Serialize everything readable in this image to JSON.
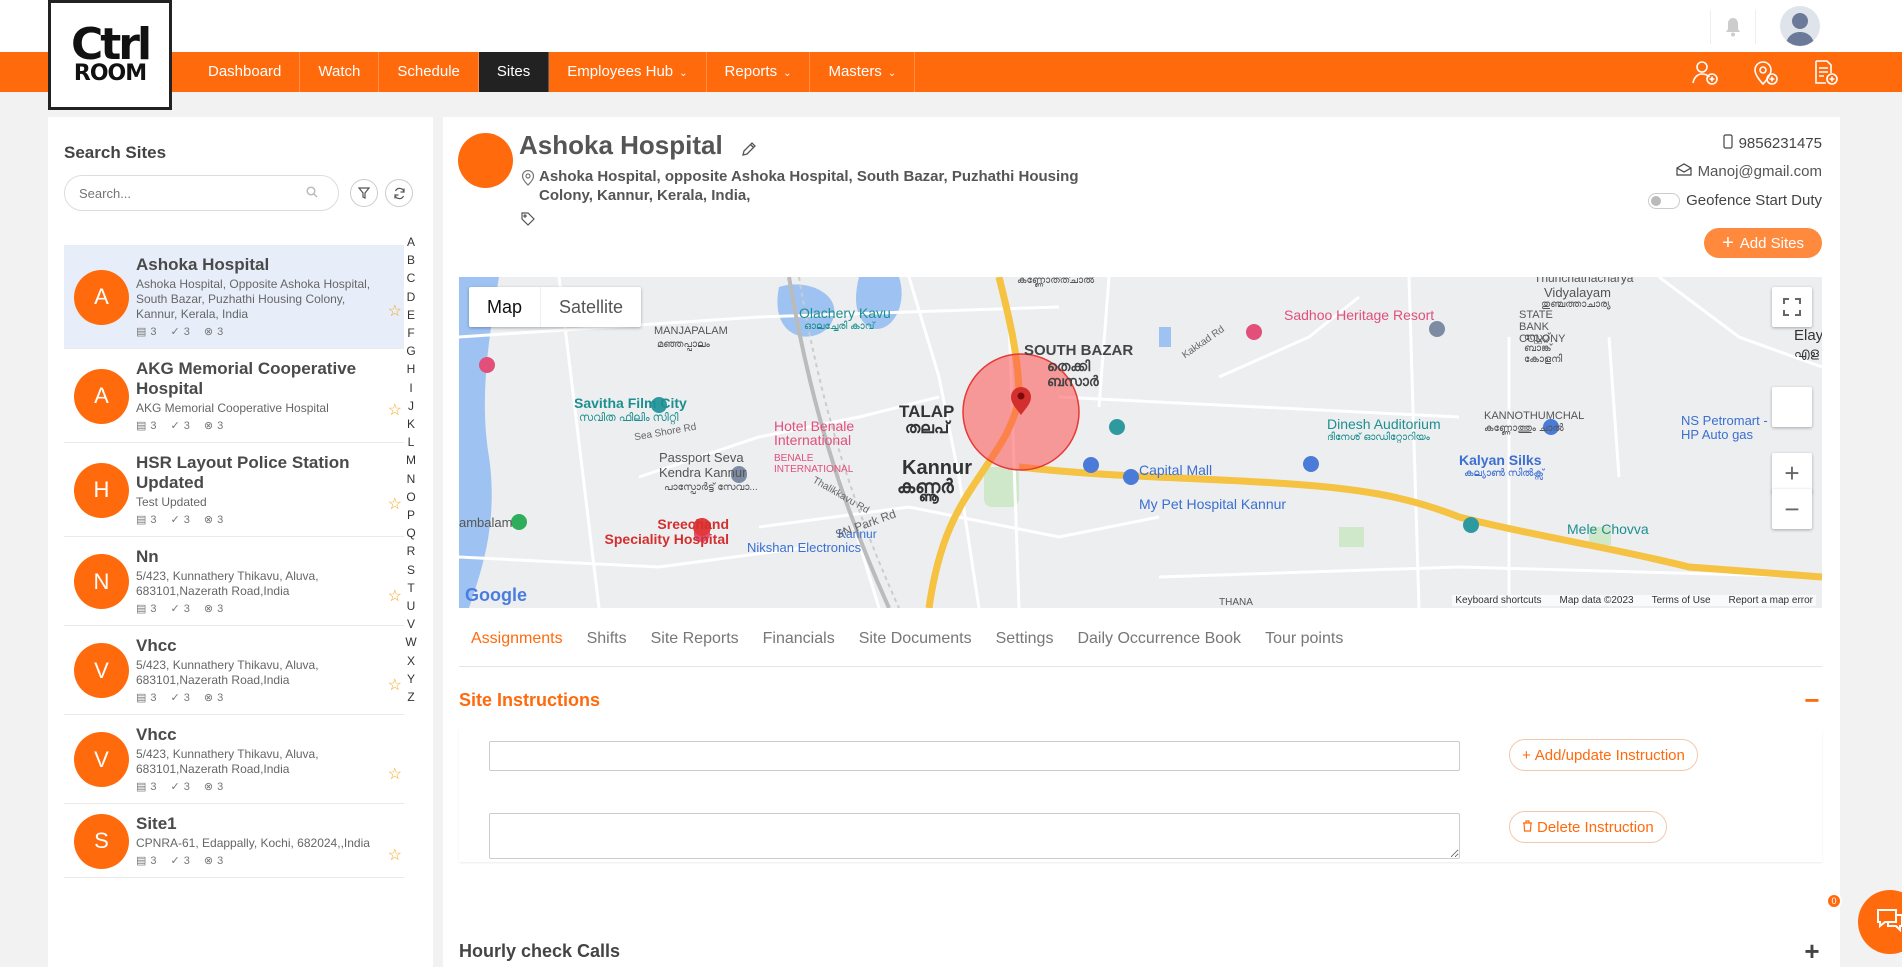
{
  "brand": {
    "logo_line1": "Ctrl",
    "logo_line2": "ROOM",
    "accent": "#ff6a0d"
  },
  "nav": {
    "items": [
      {
        "label": "Dashboard"
      },
      {
        "label": "Watch"
      },
      {
        "label": "Schedule"
      },
      {
        "label": "Sites",
        "active": true
      },
      {
        "label": "Employees Hub",
        "dropdown": true
      },
      {
        "label": "Reports",
        "dropdown": true
      },
      {
        "label": "Masters",
        "dropdown": true
      }
    ],
    "right_icons": [
      "add-user-icon",
      "add-location-icon",
      "add-document-icon"
    ]
  },
  "sidebar": {
    "title": "Search Sites",
    "search_placeholder": "Search...",
    "sites": [
      {
        "initial": "A",
        "name": "Ashoka Hospital",
        "address": "Ashoka Hospital, Opposite Ashoka Hospital, South Bazar, Puzhathi Housing Colony, Kannur, Kerala, India",
        "c1": "3",
        "c2": "3",
        "c3": "3",
        "selected": true
      },
      {
        "initial": "A",
        "name": "AKG Memorial Cooperative Hospital",
        "address": "AKG Memorial Cooperative Hospital",
        "c1": "3",
        "c2": "3",
        "c3": "3"
      },
      {
        "initial": "H",
        "name": "HSR Layout Police Station Updated",
        "address": "Test Updated",
        "c1": "3",
        "c2": "3",
        "c3": "3"
      },
      {
        "initial": "N",
        "name": "Nn",
        "address": "5/423, Kunnathery Thikavu, Aluva, 683101,Nazerath Road,India",
        "c1": "3",
        "c2": "3",
        "c3": "3"
      },
      {
        "initial": "V",
        "name": "Vhcc",
        "address": "5/423, Kunnathery Thikavu, Aluva, 683101,Nazerath Road,India",
        "c1": "3",
        "c2": "3",
        "c3": "3"
      },
      {
        "initial": "V",
        "name": "Vhcc",
        "address": "5/423, Kunnathery Thikavu, Aluva, 683101,Nazerath Road,India",
        "c1": "3",
        "c2": "3",
        "c3": "3"
      },
      {
        "initial": "S",
        "name": "Site1",
        "address": "CPNRA-61, Edappally, Kochi, 682024,,India",
        "c1": "3",
        "c2": "3",
        "c3": "3"
      }
    ],
    "alphabet": [
      "A",
      "B",
      "C",
      "D",
      "E",
      "F",
      "G",
      "H",
      "I",
      "J",
      "K",
      "L",
      "M",
      "N",
      "O",
      "P",
      "Q",
      "R",
      "S",
      "T",
      "U",
      "V",
      "W",
      "X",
      "Y",
      "Z"
    ]
  },
  "site": {
    "name": "Ashoka Hospital",
    "address": "Ashoka Hospital, opposite Ashoka Hospital, South Bazar, Puzhathi Housing Colony, Kannur, Kerala, India,",
    "phone": "9856231475",
    "email": "Manoj@gmail.com",
    "geofence_label": "Geofence Start Duty",
    "geofence_on": false,
    "add_sites_label": "Add Sites"
  },
  "map": {
    "type_map": "Map",
    "type_satellite": "Satellite",
    "labels": {
      "talap": "TALAP",
      "talap_ml": "തലപ്",
      "kannur": "Kannur",
      "kannur_ml": "കണ്ണൂർ",
      "south_bazar": "SOUTH BAZAR",
      "south_bazar_ml": "തെക്കി ബസാർ",
      "savitha": "Savitha Film City",
      "savitha_ml": "സവിത ഫിലിം സിറ്റി",
      "hotel": "Hotel Benale International",
      "hotel_sub": "BENALE INTERNATIONAL",
      "passport": "Passport Seva Kendra Kannur",
      "sreechand": "Sreechand Speciality Hospital",
      "capital": "Capital Mall",
      "petshop": "My Pet Hospital Kannur",
      "dinesh": "Dinesh Auditorium",
      "dinesh_ml": "ദിനേശ് ഓഡിറ്റോറിയം",
      "kalyan": "Kalyan Silks",
      "kalyan_ml": "കല്യാൺ സിൽക്സ്",
      "sadhoo": "Sadhoo Heritage Resort",
      "olachery": "Olachery Kavu",
      "olachery_ml": "ഓലച്ചേരി കാവ്",
      "manjapalam": "MANJAPALAM",
      "manjapalam_ml": "മഞ്ഞപ്പാലം",
      "statebank": "STATE BANK COLONY",
      "statebank_ml": "സ്റ്റേറ്റ് ബാങ്ക് കോളനി",
      "kannothumchal": "KANNOTHUMCHAL",
      "kannothumchal_ml": "കണ്ണോത്തും ചാൽ",
      "ns_petromart": "NS Petromart - HP Auto gas",
      "mele_chovva": "Mele Chovva",
      "nikshan": "Nikshan Electronics",
      "kannur_stn": "Kannur",
      "vidyalayam": "Vidyalayam",
      "thunchathacharya": "Thunchathacharya",
      "thunchathacharya_ml": "തുഞ്ചത്താചാര്യ",
      "elayavoor": "Elay",
      "elayavoor_ml": "എള",
      "kannothuchal_ml_top": "കണ്ണോത്ത്ചാൽ",
      "ambalam": "ambalam",
      "sea_shore": "Sea Shore Rd",
      "sn_park": "SN Park Rd",
      "thalikkavu": "Thalikkavu Rd",
      "kakkad": "Kakkad Rd",
      "thana": "THANA",
      "passport_ml": "പാസ്പോർട്ട് സേവാ..."
    },
    "footer": {
      "shortcuts": "Keyboard shortcuts",
      "mapdata": "Map data ©2023",
      "terms": "Terms of Use",
      "report": "Report a map error"
    },
    "google": "Google"
  },
  "tabs": [
    "Assignments",
    "Shifts",
    "Site Reports",
    "Financials",
    "Site Documents",
    "Settings",
    "Daily Occurrence Book",
    "Tour points"
  ],
  "instructions": {
    "title": "Site Instructions",
    "input_value": "",
    "textarea_value": "",
    "add_label": "Add/update Instruction",
    "delete_label": "Delete Instruction",
    "collapse_symbol": "−"
  },
  "hourly": {
    "title": "Hourly check Calls",
    "expand_symbol": "+"
  },
  "chat": {
    "badge": "0"
  }
}
